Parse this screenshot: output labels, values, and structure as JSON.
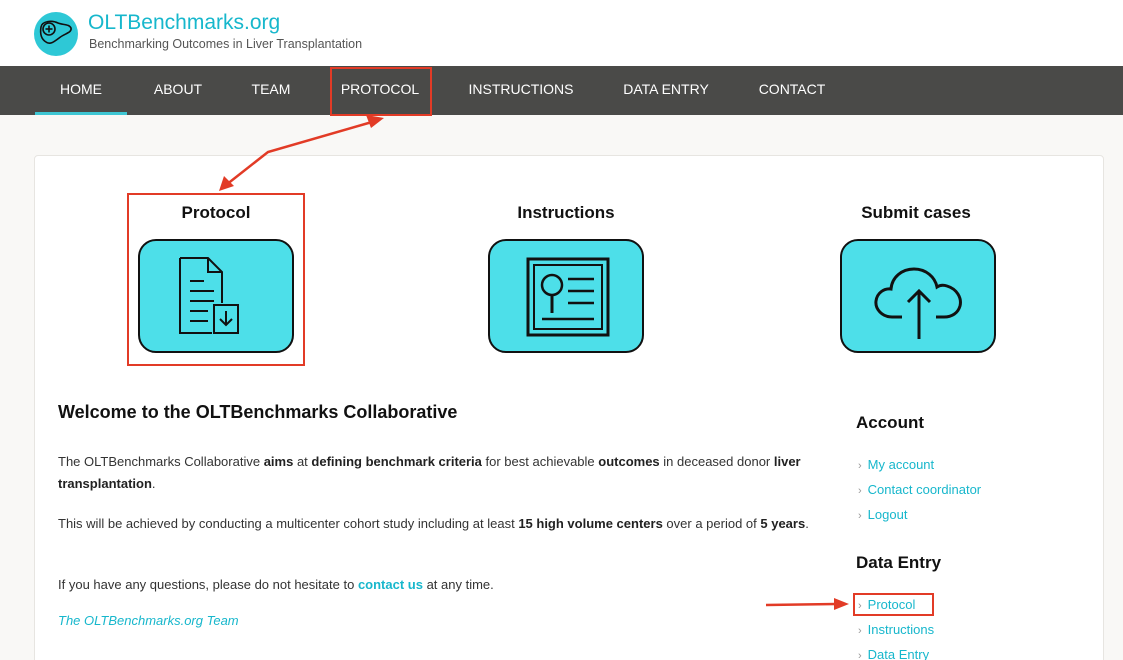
{
  "header": {
    "title": "OLTBenchmarks.org",
    "tagline": "Benchmarking Outcomes in Liver Transplantation"
  },
  "nav": {
    "items": [
      "HOME",
      "ABOUT",
      "TEAM",
      "PROTOCOL",
      "INSTRUCTIONS",
      "DATA ENTRY",
      "CONTACT"
    ],
    "active": "HOME"
  },
  "features": {
    "protocol": "Protocol",
    "instructions": "Instructions",
    "submit": "Submit cases"
  },
  "main": {
    "heading": "Welcome to the OLTBenchmarks Collaborative",
    "p1": {
      "t1": "The OLTBenchmarks Collaborative ",
      "b1": "aims",
      "t2": " at ",
      "b2": "defining benchmark criteria",
      "t3": " for best achievable ",
      "b3": "outcomes",
      "t4": " in deceased donor ",
      "b4": "liver transplantation",
      "t5": "."
    },
    "p2": {
      "t1": "This will be achieved by conducting a multicenter cohort study including at least ",
      "b1": "15 high volume centers",
      "t2": " over a period of ",
      "b2": "5 years",
      "t3": "."
    },
    "p3": {
      "t1": "If you have any questions, please do not hesitate to ",
      "link": "contact us",
      "t2": " at any time."
    },
    "signature": "The OLTBenchmarks.org Team"
  },
  "sidebar": {
    "account_heading": "Account",
    "account_links": [
      "My account",
      "Contact coordinator",
      "Logout"
    ],
    "data_entry_heading": "Data Entry",
    "data_entry_links": [
      "Protocol",
      "Instructions",
      "Data Entry"
    ]
  },
  "colors": {
    "accent": "#17b7cc",
    "nav_bg": "#4a4a48",
    "icon_fill": "#4ddfe9",
    "annotation": "#e23b26"
  },
  "icons": {
    "logo": "liver-plus-icon",
    "protocol": "document-download-icon",
    "instructions": "document-magnifier-icon",
    "submit": "cloud-upload-icon"
  }
}
